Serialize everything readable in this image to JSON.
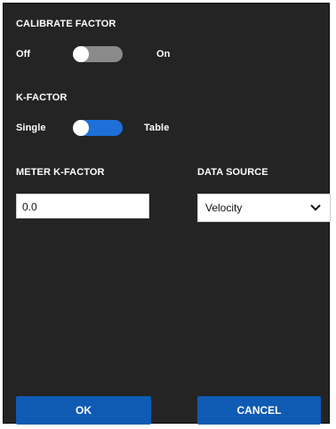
{
  "calibrate_factor": {
    "title": "CALIBRATE FACTOR",
    "off_label": "Off",
    "on_label": "On",
    "state": "off"
  },
  "k_factor": {
    "title": "K-FACTOR",
    "left_label": "Single",
    "right_label": "Table",
    "state": "single"
  },
  "meter_k_factor": {
    "label": "METER K-FACTOR",
    "value": "0.0"
  },
  "data_source": {
    "label": "DATA SOURCE",
    "selected": "Velocity",
    "icon": "chevron-down-icon"
  },
  "buttons": {
    "ok": "OK",
    "cancel": "CANCEL"
  },
  "colors": {
    "background": "#242424",
    "accent": "#1e70d8",
    "button": "#0f5bb3",
    "toggle_off": "#8a8a8a"
  }
}
